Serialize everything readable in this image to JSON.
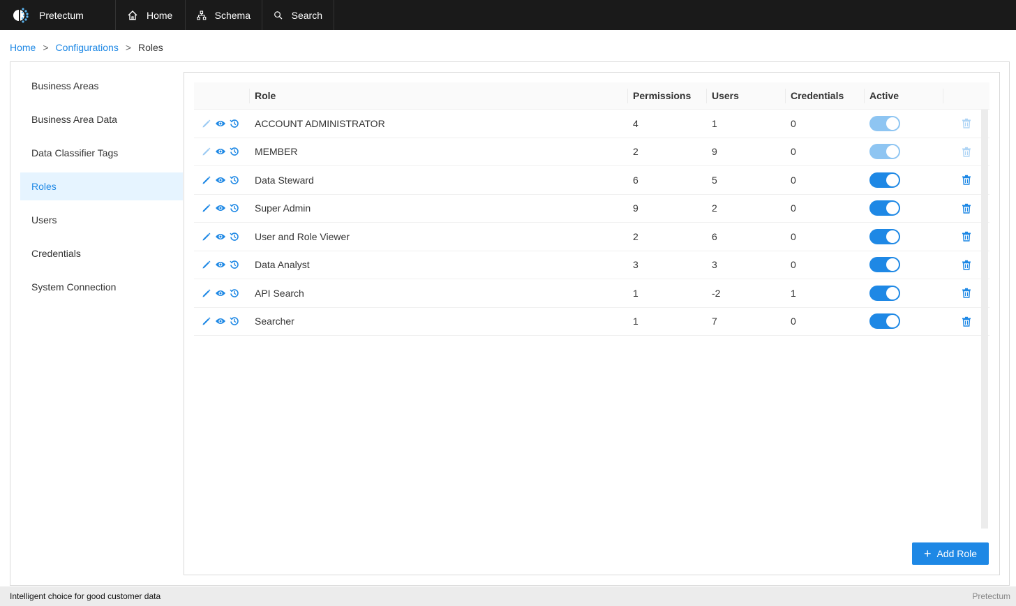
{
  "app": {
    "name": "Pretectum"
  },
  "nav": [
    {
      "label": "Home",
      "icon": "home-icon"
    },
    {
      "label": "Schema",
      "icon": "schema-icon"
    },
    {
      "label": "Search",
      "icon": "search-icon"
    }
  ],
  "breadcrumb": {
    "home": "Home",
    "configurations": "Configurations",
    "current": "Roles",
    "separator": ">"
  },
  "sidebar": {
    "items": [
      {
        "label": "Business Areas"
      },
      {
        "label": "Business Area Data"
      },
      {
        "label": "Data Classifier Tags"
      },
      {
        "label": "Roles",
        "active": true
      },
      {
        "label": "Users"
      },
      {
        "label": "Credentials"
      },
      {
        "label": "System Connection"
      }
    ]
  },
  "table": {
    "columns": {
      "role": "Role",
      "permissions": "Permissions",
      "users": "Users",
      "credentials": "Credentials",
      "active": "Active"
    },
    "rows": [
      {
        "role": "ACCOUNT ADMINISTRATOR",
        "permissions": "4",
        "users": "1",
        "credentials": "0",
        "active": true,
        "editable": false
      },
      {
        "role": "MEMBER",
        "permissions": "2",
        "users": "9",
        "credentials": "0",
        "active": true,
        "editable": false
      },
      {
        "role": "Data Steward",
        "permissions": "6",
        "users": "5",
        "credentials": "0",
        "active": true,
        "editable": true
      },
      {
        "role": "Super Admin",
        "permissions": "9",
        "users": "2",
        "credentials": "0",
        "active": true,
        "editable": true
      },
      {
        "role": "User and Role Viewer",
        "permissions": "2",
        "users": "6",
        "credentials": "0",
        "active": true,
        "editable": true
      },
      {
        "role": "Data Analyst",
        "permissions": "3",
        "users": "3",
        "credentials": "0",
        "active": true,
        "editable": true
      },
      {
        "role": "API Search",
        "permissions": "1",
        "users": "-2",
        "credentials": "1",
        "active": true,
        "editable": true
      },
      {
        "role": "Searcher",
        "permissions": "1",
        "users": "7",
        "credentials": "0",
        "active": true,
        "editable": true
      }
    ]
  },
  "add_button": {
    "label": "Add Role",
    "icon": "plus-icon"
  },
  "footer": {
    "tagline": "Intelligent choice for good customer data",
    "brand": "Pretectum"
  },
  "colors": {
    "accent": "#1e88e5",
    "topbar": "#1a1a1a",
    "active_bg": "#e6f4ff",
    "disabled_toggle": "#8ec5f2"
  }
}
